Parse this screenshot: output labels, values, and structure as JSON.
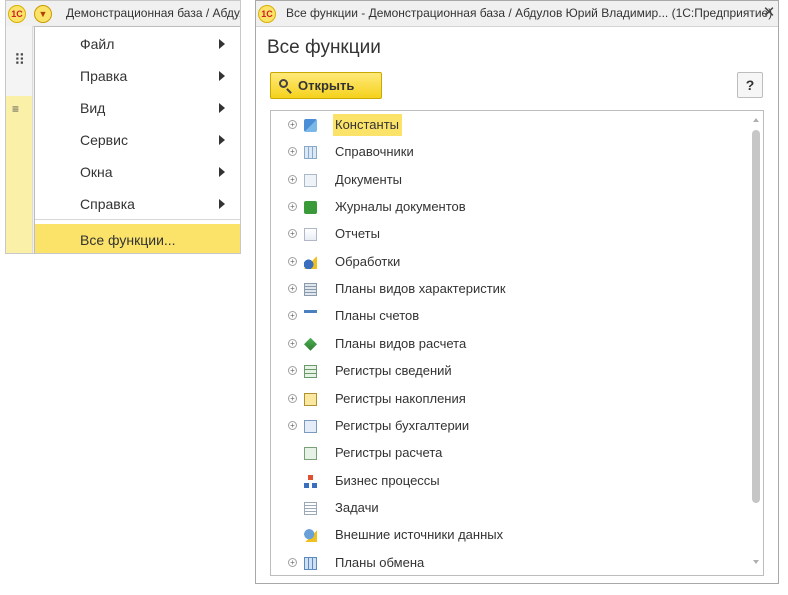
{
  "main_window": {
    "title": "Демонстрационная база / Абдулов Юрий Владимирович",
    "menu": {
      "items": [
        {
          "label": "Файл",
          "submenu": true
        },
        {
          "label": "Правка",
          "submenu": true
        },
        {
          "label": "Вид",
          "submenu": true
        },
        {
          "label": "Сервис",
          "submenu": true
        },
        {
          "label": "Окна",
          "submenu": true
        },
        {
          "label": "Справка",
          "submenu": true
        }
      ],
      "all_functions": "Все функции..."
    }
  },
  "functions_window": {
    "title": "Все функции - Демонстрационная база / Абдулов Юрий Владимир... (1С:Предприятие)",
    "heading": "Все функции",
    "open_button": "Открыть",
    "help_button": "?",
    "tree": [
      {
        "label": "Константы",
        "expandable": true,
        "selected": true,
        "icon": "constants-icon"
      },
      {
        "label": "Справочники",
        "expandable": true,
        "icon": "catalogs-icon"
      },
      {
        "label": "Документы",
        "expandable": true,
        "icon": "documents-icon"
      },
      {
        "label": "Журналы документов",
        "expandable": true,
        "icon": "document-journals-icon"
      },
      {
        "label": "Отчеты",
        "expandable": true,
        "icon": "reports-icon"
      },
      {
        "label": "Обработки",
        "expandable": true,
        "icon": "data-processors-icon"
      },
      {
        "label": "Планы видов характеристик",
        "expandable": true,
        "icon": "characteristic-types-icon"
      },
      {
        "label": "Планы счетов",
        "expandable": true,
        "icon": "charts-of-accounts-icon"
      },
      {
        "label": "Планы видов расчета",
        "expandable": true,
        "icon": "calculation-types-icon"
      },
      {
        "label": "Регистры сведений",
        "expandable": true,
        "icon": "information-registers-icon"
      },
      {
        "label": "Регистры накопления",
        "expandable": true,
        "icon": "accumulation-registers-icon"
      },
      {
        "label": "Регистры бухгалтерии",
        "expandable": true,
        "icon": "accounting-registers-icon"
      },
      {
        "label": "Регистры расчета",
        "expandable": false,
        "icon": "calculation-registers-icon"
      },
      {
        "label": "Бизнес процессы",
        "expandable": false,
        "icon": "business-processes-icon"
      },
      {
        "label": "Задачи",
        "expandable": false,
        "icon": "tasks-icon"
      },
      {
        "label": "Внешние источники данных",
        "expandable": false,
        "icon": "external-data-sources-icon"
      },
      {
        "label": "Планы обмена",
        "expandable": true,
        "icon": "exchange-plans-icon"
      }
    ]
  },
  "colors": {
    "highlight": "#fbe36a",
    "button_yellow": "#f5d21c",
    "text": "#333333"
  }
}
